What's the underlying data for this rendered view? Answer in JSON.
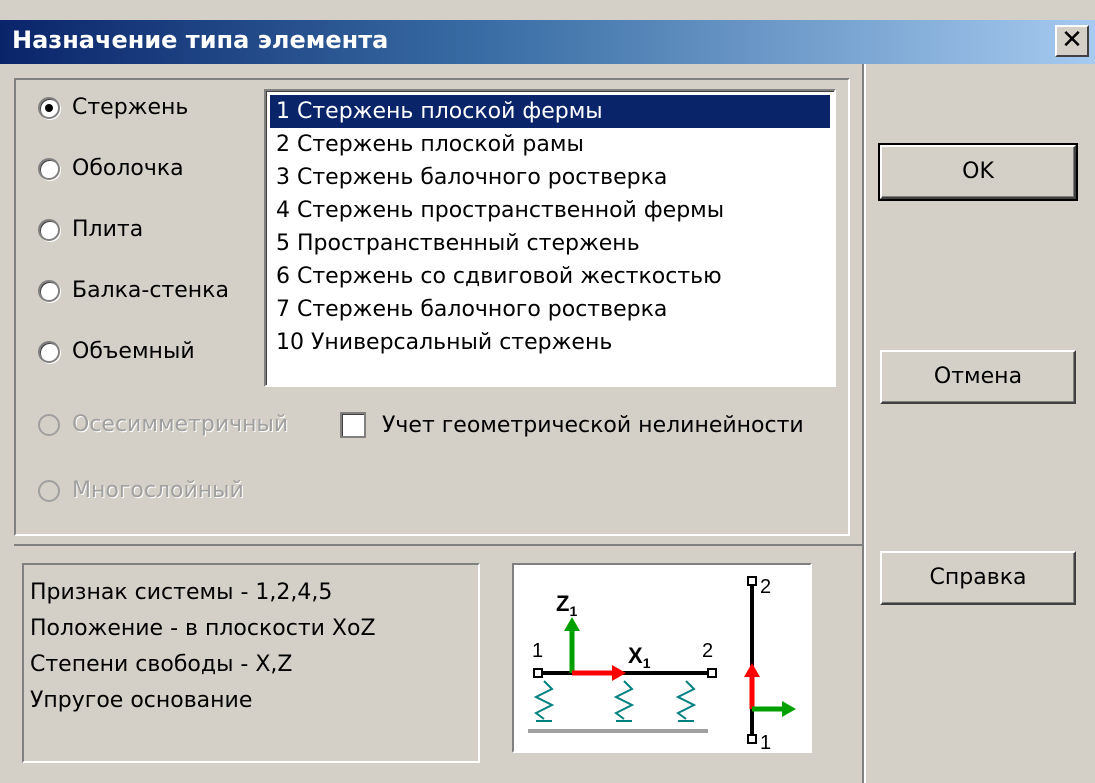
{
  "window": {
    "title": "Назначение типа элемента",
    "close_label": "✕"
  },
  "element_types": [
    {
      "label": "Стержень",
      "checked": true,
      "enabled": true
    },
    {
      "label": "Оболочка",
      "checked": false,
      "enabled": true
    },
    {
      "label": "Плита",
      "checked": false,
      "enabled": true
    },
    {
      "label": "Балка-стенка",
      "checked": false,
      "enabled": true
    },
    {
      "label": "Объемный",
      "checked": false,
      "enabled": true
    },
    {
      "label": "Осесимметричный",
      "checked": false,
      "enabled": false
    },
    {
      "label": "Многослойный",
      "checked": false,
      "enabled": false
    }
  ],
  "type_list": {
    "items": [
      "1 Стержень плоской фермы",
      "2 Стержень плоской рамы",
      "3 Стержень балочного ростверка",
      "4 Стержень пространственной фермы",
      "5 Пространственный стержень",
      "6 Стержень со сдвиговой жесткостью",
      "7 Стержень балочного ростверка",
      "10 Универсальный стержень"
    ],
    "selected_index": 0
  },
  "geometric_nonlinearity": {
    "label": "Учет геометрической нелинейности",
    "checked": false
  },
  "buttons": {
    "ok": "OK",
    "cancel": "Отмена",
    "help": "Справка"
  },
  "info": {
    "lines": [
      "Признак системы - 1,2,4,5",
      "Положение - в плоскости XoZ",
      "Степени свободы - X,Z",
      "Упругое основание"
    ]
  },
  "diagram": {
    "node_start": "1",
    "node_end": "2",
    "axis_z": "Z",
    "axis_x": "X",
    "axis_subscript": "1",
    "vertical_node_top": "2",
    "vertical_node_bottom": "1",
    "colors": {
      "z_axis": "#00a000",
      "x_axis": "#ff0000",
      "springs": "#008080",
      "ground": "#a0a0a0",
      "member": "#000000"
    }
  }
}
